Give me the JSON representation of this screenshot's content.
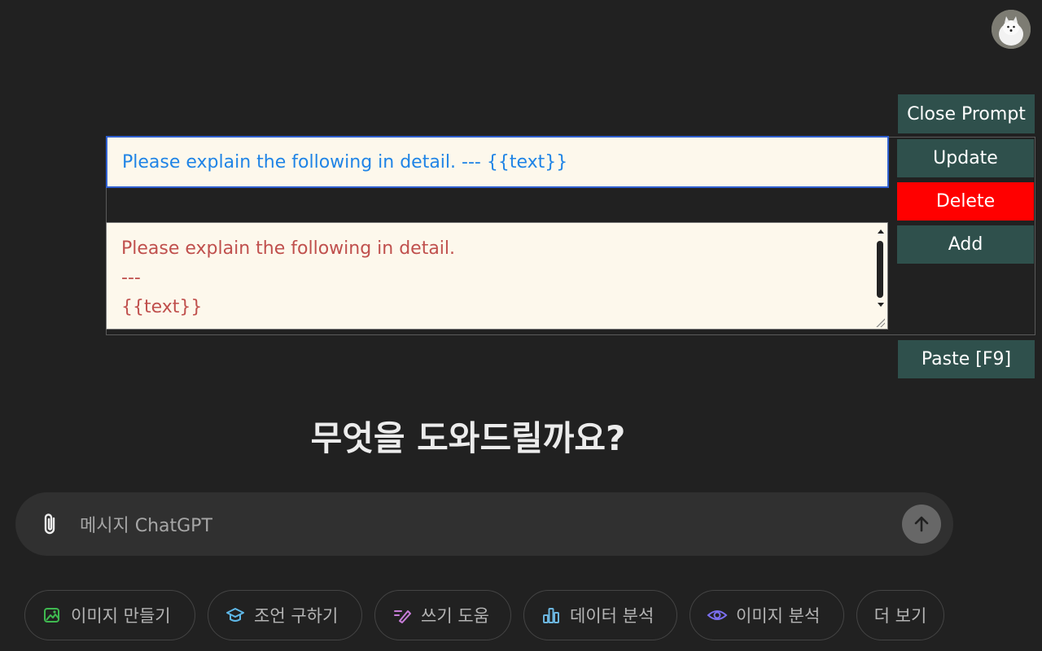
{
  "prompt_panel": {
    "title_value": "Please explain the following in detail. --- {{text}}",
    "body_lines": [
      "Please explain the following in detail.",
      "---",
      "{{text}}"
    ],
    "buttons": {
      "close_prompt": "Close Prompt",
      "update": "Update",
      "delete": "Delete",
      "add": "Add",
      "paste": "Paste [F9]"
    }
  },
  "main": {
    "heading": "무엇을 도와드릴까요?",
    "composer_placeholder": "메시지 ChatGPT"
  },
  "suggestions": [
    {
      "label": "이미지 만들기",
      "icon": "image-create-icon",
      "color": "#3fb950"
    },
    {
      "label": "조언 구하기",
      "icon": "graduation-cap-icon",
      "color": "#5fb8e8"
    },
    {
      "label": "쓰기 도움",
      "icon": "pen-icon",
      "color": "#c77dd8"
    },
    {
      "label": "데이터 분석",
      "icon": "bar-chart-icon",
      "color": "#6cb6e0"
    },
    {
      "label": "이미지 분석",
      "icon": "eye-icon",
      "color": "#7b6ff0"
    },
    {
      "label": "더 보기",
      "icon": "",
      "color": ""
    }
  ],
  "colors": {
    "background": "#212121",
    "button_teal": "#2f504c",
    "delete_red": "#ff0000",
    "input_bg": "#fdf8ec"
  }
}
